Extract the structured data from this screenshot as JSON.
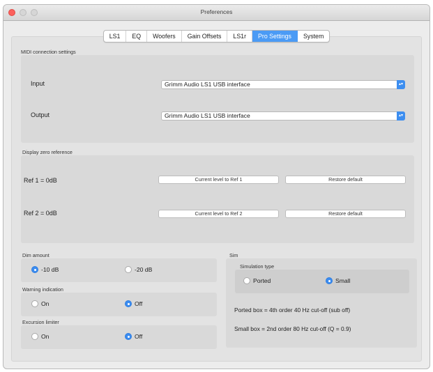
{
  "window": {
    "title": "Preferences"
  },
  "tabs": [
    "LS1",
    "EQ",
    "Woofers",
    "Gain Offsets",
    "LS1r",
    "Pro Settings",
    "System"
  ],
  "active_tab": "Pro Settings",
  "midi": {
    "group_label": "MIDI connection settings",
    "input_label": "Input",
    "input_value": "Grimm Audio LS1 USB interface",
    "output_label": "Output",
    "output_value": "Grimm Audio LS1 USB interface"
  },
  "zero_ref": {
    "group_label": "Display zero reference",
    "ref1_label": "Ref 1 = 0dB",
    "ref1_button": "Current level to Ref 1",
    "ref1_restore": "Restore default",
    "ref2_label": "Ref 2 = 0dB",
    "ref2_button": "Current level to Ref 2",
    "ref2_restore": "Restore default"
  },
  "dim": {
    "label": "Dim amount",
    "opt1": "-10 dB",
    "opt2": "-20 dB",
    "selected": "-10 dB"
  },
  "warning": {
    "label": "Warning indication",
    "opt1": "On",
    "opt2": "Off",
    "selected": "Off"
  },
  "excursion": {
    "label": "Excursion limiter",
    "opt1": "On",
    "opt2": "Off",
    "selected": "Off"
  },
  "sim": {
    "label": "Sim",
    "type_label": "Simulation type",
    "opt1": "Ported",
    "opt2": "Small",
    "selected": "Small",
    "ported_info": "Ported box = 4th order 40 Hz cut-off (sub off)",
    "small_info": "Small box = 2nd order 80 Hz cut-off (Q = 0.9)"
  },
  "colors": {
    "accent": "#3b8cf0",
    "close": "#fc605c"
  }
}
